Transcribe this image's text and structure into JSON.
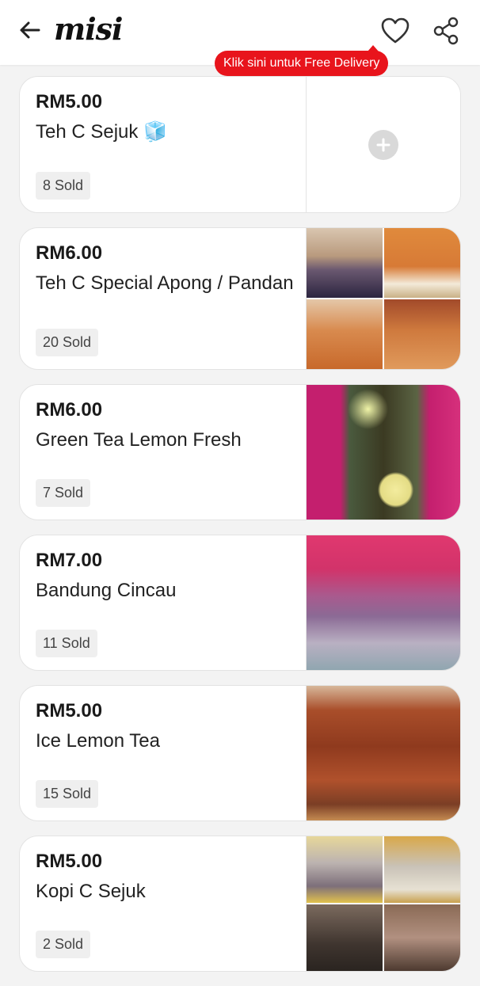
{
  "header": {
    "logo": "misi",
    "back_icon": "arrow-left-icon",
    "favorite_icon": "heart-icon",
    "share_icon": "share-icon",
    "promo": "Klik sini untuk Free Delivery",
    "promo_color": "#e8141c"
  },
  "items": [
    {
      "price": "RM5.00",
      "name": "Teh C Sejuk 🧊",
      "sold": "8 Sold",
      "image": "none"
    },
    {
      "price": "RM6.00",
      "name": "Teh C Special Apong / Pandan",
      "sold": "20 Sold",
      "image": "grid"
    },
    {
      "price": "RM6.00",
      "name": "Green Tea Lemon Fresh",
      "sold": "7 Sold",
      "image": "photo"
    },
    {
      "price": "RM7.00",
      "name": "Bandung Cincau",
      "sold": "11 Sold",
      "image": "photo"
    },
    {
      "price": "RM5.00",
      "name": "Ice Lemon Tea",
      "sold": "15 Sold",
      "image": "photo"
    },
    {
      "price": "RM5.00",
      "name": "Kopi C Sejuk",
      "sold": "2 Sold",
      "image": "grid"
    }
  ]
}
